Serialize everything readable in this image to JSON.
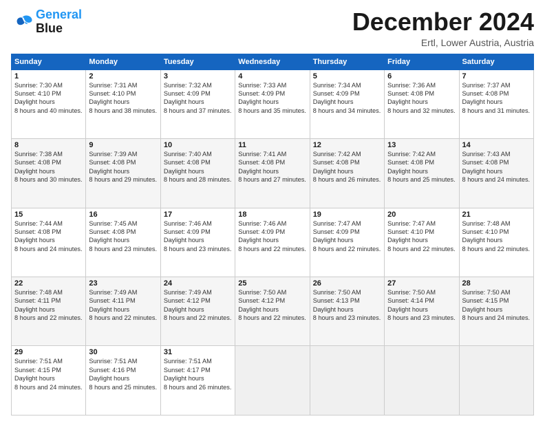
{
  "logo": {
    "line1": "General",
    "line2": "Blue"
  },
  "header": {
    "month": "December 2024",
    "location": "Ertl, Lower Austria, Austria"
  },
  "weekdays": [
    "Sunday",
    "Monday",
    "Tuesday",
    "Wednesday",
    "Thursday",
    "Friday",
    "Saturday"
  ],
  "weeks": [
    [
      {
        "day": "1",
        "sunrise": "7:30 AM",
        "sunset": "4:10 PM",
        "daylight": "8 hours and 40 minutes."
      },
      {
        "day": "2",
        "sunrise": "7:31 AM",
        "sunset": "4:10 PM",
        "daylight": "8 hours and 38 minutes."
      },
      {
        "day": "3",
        "sunrise": "7:32 AM",
        "sunset": "4:09 PM",
        "daylight": "8 hours and 37 minutes."
      },
      {
        "day": "4",
        "sunrise": "7:33 AM",
        "sunset": "4:09 PM",
        "daylight": "8 hours and 35 minutes."
      },
      {
        "day": "5",
        "sunrise": "7:34 AM",
        "sunset": "4:09 PM",
        "daylight": "8 hours and 34 minutes."
      },
      {
        "day": "6",
        "sunrise": "7:36 AM",
        "sunset": "4:08 PM",
        "daylight": "8 hours and 32 minutes."
      },
      {
        "day": "7",
        "sunrise": "7:37 AM",
        "sunset": "4:08 PM",
        "daylight": "8 hours and 31 minutes."
      }
    ],
    [
      {
        "day": "8",
        "sunrise": "7:38 AM",
        "sunset": "4:08 PM",
        "daylight": "8 hours and 30 minutes."
      },
      {
        "day": "9",
        "sunrise": "7:39 AM",
        "sunset": "4:08 PM",
        "daylight": "8 hours and 29 minutes."
      },
      {
        "day": "10",
        "sunrise": "7:40 AM",
        "sunset": "4:08 PM",
        "daylight": "8 hours and 28 minutes."
      },
      {
        "day": "11",
        "sunrise": "7:41 AM",
        "sunset": "4:08 PM",
        "daylight": "8 hours and 27 minutes."
      },
      {
        "day": "12",
        "sunrise": "7:42 AM",
        "sunset": "4:08 PM",
        "daylight": "8 hours and 26 minutes."
      },
      {
        "day": "13",
        "sunrise": "7:42 AM",
        "sunset": "4:08 PM",
        "daylight": "8 hours and 25 minutes."
      },
      {
        "day": "14",
        "sunrise": "7:43 AM",
        "sunset": "4:08 PM",
        "daylight": "8 hours and 24 minutes."
      }
    ],
    [
      {
        "day": "15",
        "sunrise": "7:44 AM",
        "sunset": "4:08 PM",
        "daylight": "8 hours and 24 minutes."
      },
      {
        "day": "16",
        "sunrise": "7:45 AM",
        "sunset": "4:08 PM",
        "daylight": "8 hours and 23 minutes."
      },
      {
        "day": "17",
        "sunrise": "7:46 AM",
        "sunset": "4:09 PM",
        "daylight": "8 hours and 23 minutes."
      },
      {
        "day": "18",
        "sunrise": "7:46 AM",
        "sunset": "4:09 PM",
        "daylight": "8 hours and 22 minutes."
      },
      {
        "day": "19",
        "sunrise": "7:47 AM",
        "sunset": "4:09 PM",
        "daylight": "8 hours and 22 minutes."
      },
      {
        "day": "20",
        "sunrise": "7:47 AM",
        "sunset": "4:10 PM",
        "daylight": "8 hours and 22 minutes."
      },
      {
        "day": "21",
        "sunrise": "7:48 AM",
        "sunset": "4:10 PM",
        "daylight": "8 hours and 22 minutes."
      }
    ],
    [
      {
        "day": "22",
        "sunrise": "7:48 AM",
        "sunset": "4:11 PM",
        "daylight": "8 hours and 22 minutes."
      },
      {
        "day": "23",
        "sunrise": "7:49 AM",
        "sunset": "4:11 PM",
        "daylight": "8 hours and 22 minutes."
      },
      {
        "day": "24",
        "sunrise": "7:49 AM",
        "sunset": "4:12 PM",
        "daylight": "8 hours and 22 minutes."
      },
      {
        "day": "25",
        "sunrise": "7:50 AM",
        "sunset": "4:12 PM",
        "daylight": "8 hours and 22 minutes."
      },
      {
        "day": "26",
        "sunrise": "7:50 AM",
        "sunset": "4:13 PM",
        "daylight": "8 hours and 23 minutes."
      },
      {
        "day": "27",
        "sunrise": "7:50 AM",
        "sunset": "4:14 PM",
        "daylight": "8 hours and 23 minutes."
      },
      {
        "day": "28",
        "sunrise": "7:50 AM",
        "sunset": "4:15 PM",
        "daylight": "8 hours and 24 minutes."
      }
    ],
    [
      {
        "day": "29",
        "sunrise": "7:51 AM",
        "sunset": "4:15 PM",
        "daylight": "8 hours and 24 minutes."
      },
      {
        "day": "30",
        "sunrise": "7:51 AM",
        "sunset": "4:16 PM",
        "daylight": "8 hours and 25 minutes."
      },
      {
        "day": "31",
        "sunrise": "7:51 AM",
        "sunset": "4:17 PM",
        "daylight": "8 hours and 26 minutes."
      },
      null,
      null,
      null,
      null
    ]
  ]
}
